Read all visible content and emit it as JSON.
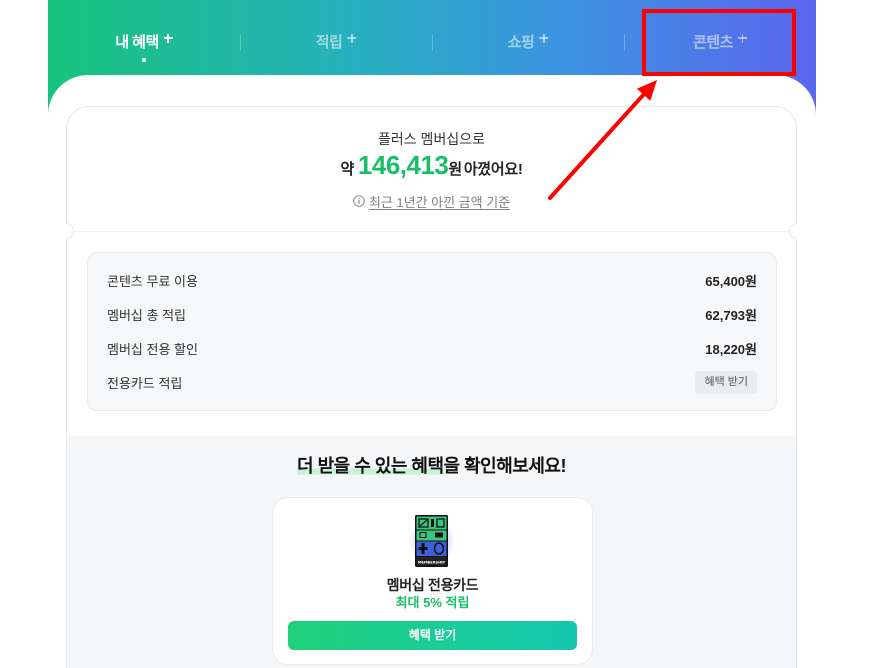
{
  "header": {
    "tabs": [
      {
        "label": "내 혜택",
        "active": true
      },
      {
        "label": "적립",
        "active": false
      },
      {
        "label": "쇼핑",
        "active": false
      },
      {
        "label": "콘텐츠",
        "active": false
      }
    ],
    "tab_icon": "plus-icon"
  },
  "summary": {
    "intro": "플러스 멤버십으로",
    "prefix": "약",
    "amount": "146,413",
    "unit": "원",
    "suffix": "아꼈어요!",
    "basis_icon": "info-circle-icon",
    "basis": "최근 1년간 아낀 금액 기준"
  },
  "breakdown": [
    {
      "label": "콘텐츠 무료 이용",
      "value": "65,400원"
    },
    {
      "label": "멤버십 총 적립",
      "value": "62,793원"
    },
    {
      "label": "멤버십 전용 할인",
      "value": "18,220원"
    },
    {
      "label": "전용카드 적립",
      "action": "혜택 받기"
    }
  ],
  "more_benefits": {
    "title_highlight": "더 받을 수 있는 혜택",
    "title_rest": "을 확인해보세요!",
    "card": {
      "image": "membership-card-image",
      "image_text": "MEMBERSHIP",
      "name": "멤버십 전용카드",
      "benefit": "최대 5% 적립",
      "button": "혜택 받기"
    }
  },
  "colors": {
    "header_gradient": [
      "#18c47c",
      "#27b0bf",
      "#3d92e2",
      "#5b65ee"
    ],
    "accent_green": "#19bf67",
    "annotation_red": "#ff0000"
  }
}
